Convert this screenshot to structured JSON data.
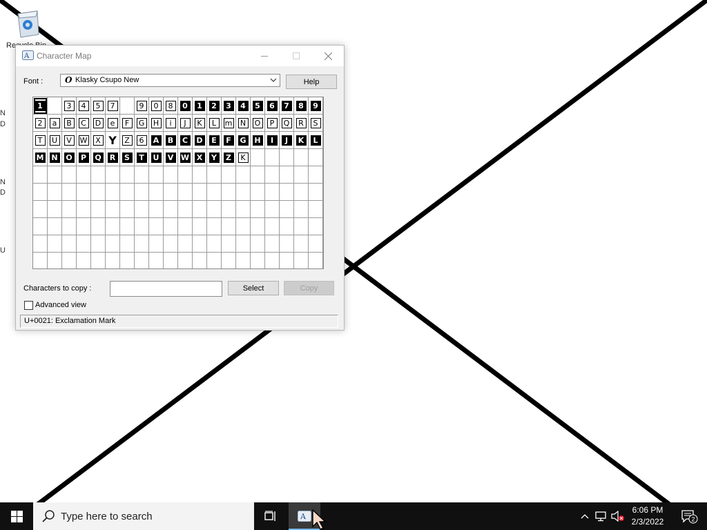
{
  "desktop": {
    "recycle_bin_label": "Recycle Bin",
    "left_edge_fragments": [
      "N",
      "D",
      "N",
      "D",
      "U"
    ]
  },
  "window": {
    "title": "Character Map",
    "font_label": "Font :",
    "font_value": "Klasky Csupo New",
    "help_button": "Help",
    "chars_to_copy_label": "Characters to copy :",
    "chars_to_copy_value": "",
    "select_button": "Select",
    "copy_button": "Copy",
    "advanced_view_label": "Advanced view",
    "advanced_view_checked": false,
    "status_text": "U+0021: Exclamation Mark",
    "selected_cell_index": 0,
    "grid_columns": 20,
    "grid_rows": 10,
    "glyphs": [
      {
        "t": "1",
        "s": "inv"
      },
      {
        "t": "",
        "s": "none"
      },
      {
        "t": "3",
        "s": "box"
      },
      {
        "t": "4",
        "s": "box"
      },
      {
        "t": "5",
        "s": "box"
      },
      {
        "t": "7",
        "s": "box"
      },
      {
        "t": "",
        "s": "none"
      },
      {
        "t": "9",
        "s": "box"
      },
      {
        "t": "0",
        "s": "box"
      },
      {
        "t": "8",
        "s": "box"
      },
      {
        "t": "0",
        "s": "inv"
      },
      {
        "t": "1",
        "s": "inv"
      },
      {
        "t": "2",
        "s": "inv"
      },
      {
        "t": "3",
        "s": "inv"
      },
      {
        "t": "4",
        "s": "inv"
      },
      {
        "t": "5",
        "s": "inv"
      },
      {
        "t": "6",
        "s": "inv"
      },
      {
        "t": "7",
        "s": "inv"
      },
      {
        "t": "8",
        "s": "inv"
      },
      {
        "t": "9",
        "s": "inv"
      },
      {
        "t": "2",
        "s": "box"
      },
      {
        "t": "a",
        "s": "box"
      },
      {
        "t": "B",
        "s": "box"
      },
      {
        "t": "C",
        "s": "box"
      },
      {
        "t": "D",
        "s": "box"
      },
      {
        "t": "e",
        "s": "box"
      },
      {
        "t": "F",
        "s": "box"
      },
      {
        "t": "G",
        "s": "box"
      },
      {
        "t": "H",
        "s": "box"
      },
      {
        "t": "i",
        "s": "box"
      },
      {
        "t": "J",
        "s": "box"
      },
      {
        "t": "K",
        "s": "box"
      },
      {
        "t": "L",
        "s": "box"
      },
      {
        "t": "m",
        "s": "box"
      },
      {
        "t": "N",
        "s": "box"
      },
      {
        "t": "O",
        "s": "box"
      },
      {
        "t": "P",
        "s": "box"
      },
      {
        "t": "Q",
        "s": "box"
      },
      {
        "t": "R",
        "s": "box"
      },
      {
        "t": "S",
        "s": "box"
      },
      {
        "t": "T",
        "s": "box"
      },
      {
        "t": "U",
        "s": "box"
      },
      {
        "t": "V",
        "s": "box"
      },
      {
        "t": "W",
        "s": "box"
      },
      {
        "t": "X",
        "s": "box"
      },
      {
        "t": "Y",
        "s": "plain"
      },
      {
        "t": "Z",
        "s": "box"
      },
      {
        "t": "6",
        "s": "box"
      },
      {
        "t": "A",
        "s": "inv"
      },
      {
        "t": "B",
        "s": "inv"
      },
      {
        "t": "C",
        "s": "inv"
      },
      {
        "t": "D",
        "s": "inv"
      },
      {
        "t": "E",
        "s": "inv"
      },
      {
        "t": "F",
        "s": "inv"
      },
      {
        "t": "G",
        "s": "inv"
      },
      {
        "t": "H",
        "s": "inv"
      },
      {
        "t": "I",
        "s": "inv"
      },
      {
        "t": "J",
        "s": "inv"
      },
      {
        "t": "K",
        "s": "inv"
      },
      {
        "t": "L",
        "s": "inv"
      },
      {
        "t": "M",
        "s": "inv"
      },
      {
        "t": "N",
        "s": "inv"
      },
      {
        "t": "O",
        "s": "inv"
      },
      {
        "t": "P",
        "s": "inv"
      },
      {
        "t": "Q",
        "s": "inv"
      },
      {
        "t": "R",
        "s": "inv"
      },
      {
        "t": "S",
        "s": "inv"
      },
      {
        "t": "T",
        "s": "inv"
      },
      {
        "t": "U",
        "s": "inv"
      },
      {
        "t": "V",
        "s": "inv"
      },
      {
        "t": "W",
        "s": "inv"
      },
      {
        "t": "X",
        "s": "inv"
      },
      {
        "t": "Y",
        "s": "inv"
      },
      {
        "t": "Z",
        "s": "inv"
      },
      {
        "t": "K",
        "s": "box"
      }
    ]
  },
  "taskbar": {
    "search_placeholder": "Type here to search",
    "time": "6:06 PM",
    "date": "2/3/2022",
    "notification_count": "2"
  }
}
